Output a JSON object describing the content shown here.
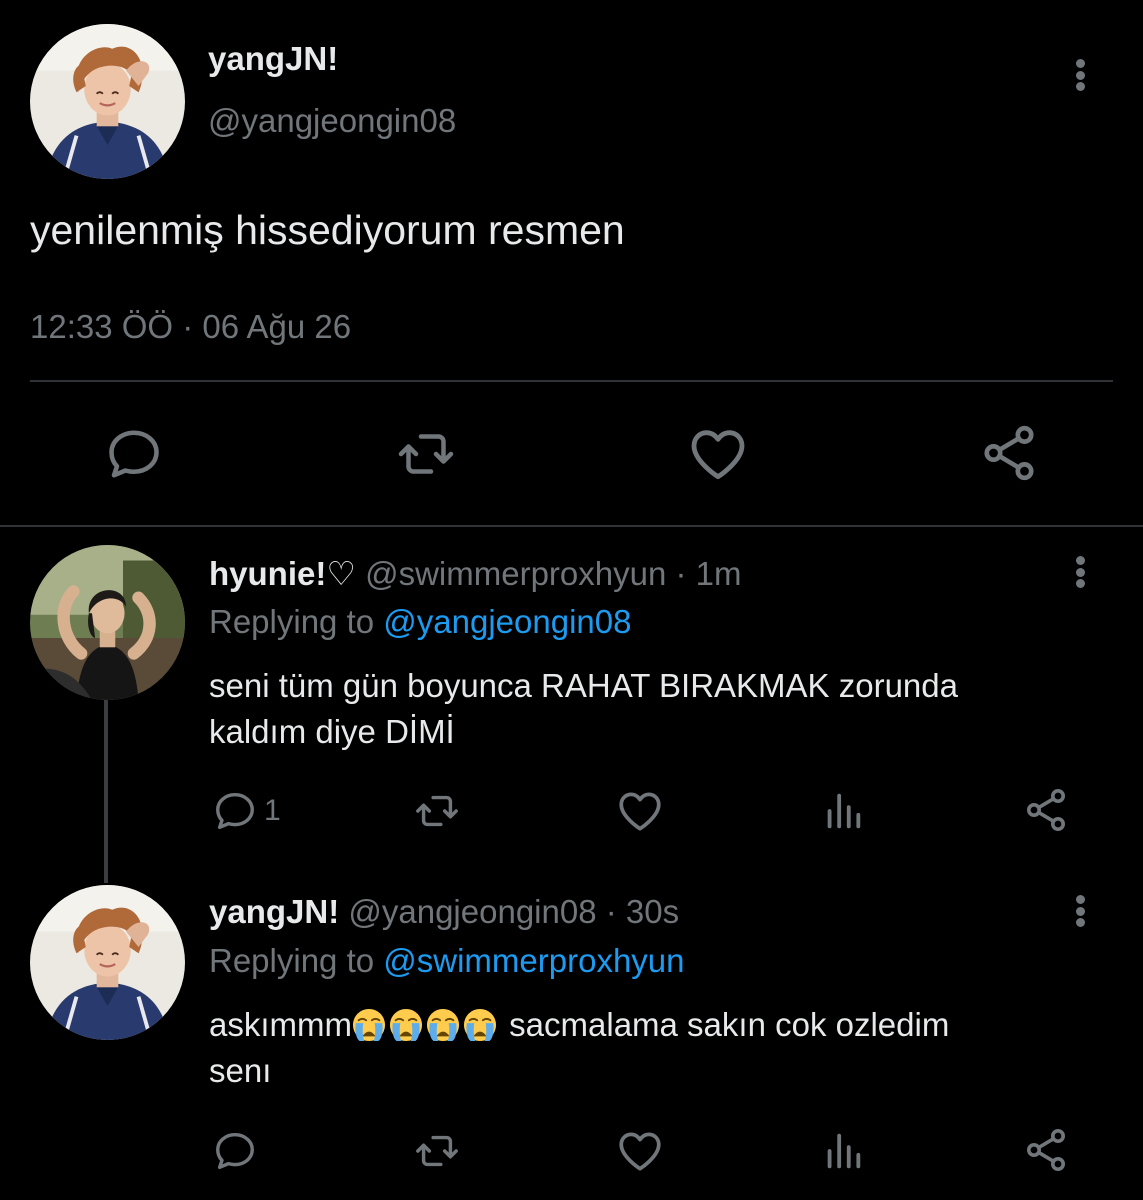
{
  "main_tweet": {
    "display_name": "yangJN!",
    "handle": "@yangjeongin08",
    "text": "yenilenmiş hissediyorum resmen",
    "timestamp": "12:33 ÖÖ · 06 Ağu 26",
    "actions": [
      "reply-icon",
      "retweet-icon",
      "like-icon",
      "share-icon"
    ]
  },
  "replies": [
    {
      "display_name": "hyunie!♡",
      "handle_time": "@swimmerproxhyun · 1m",
      "replying_prefix": "Replying to ",
      "replying_to": "@yangjeongin08",
      "text_line1": "seni tüm gün boyunca RAHAT BIRAKMAK zorunda",
      "text_line2": "kaldım diye DİMİ",
      "reply_count": "1"
    },
    {
      "display_name": "yangJN!",
      "handle_time": "@yangjeongin08 · 30s",
      "replying_prefix": "Replying to ",
      "replying_to": "@swimmerproxhyun",
      "text_start": "askımmm",
      "emojis": [
        "loudly-crying-face",
        "loudly-crying-face",
        "loudly-crying-face",
        "loudly-crying-face"
      ],
      "text_end": " sacmalama sakın cok ozledim",
      "text_line2": "senı"
    }
  ],
  "colors": {
    "background": "#000000",
    "primary_text": "#e7e9ea",
    "secondary_text": "#71767b",
    "link": "#1d9bf0",
    "divider": "#2f3336"
  }
}
